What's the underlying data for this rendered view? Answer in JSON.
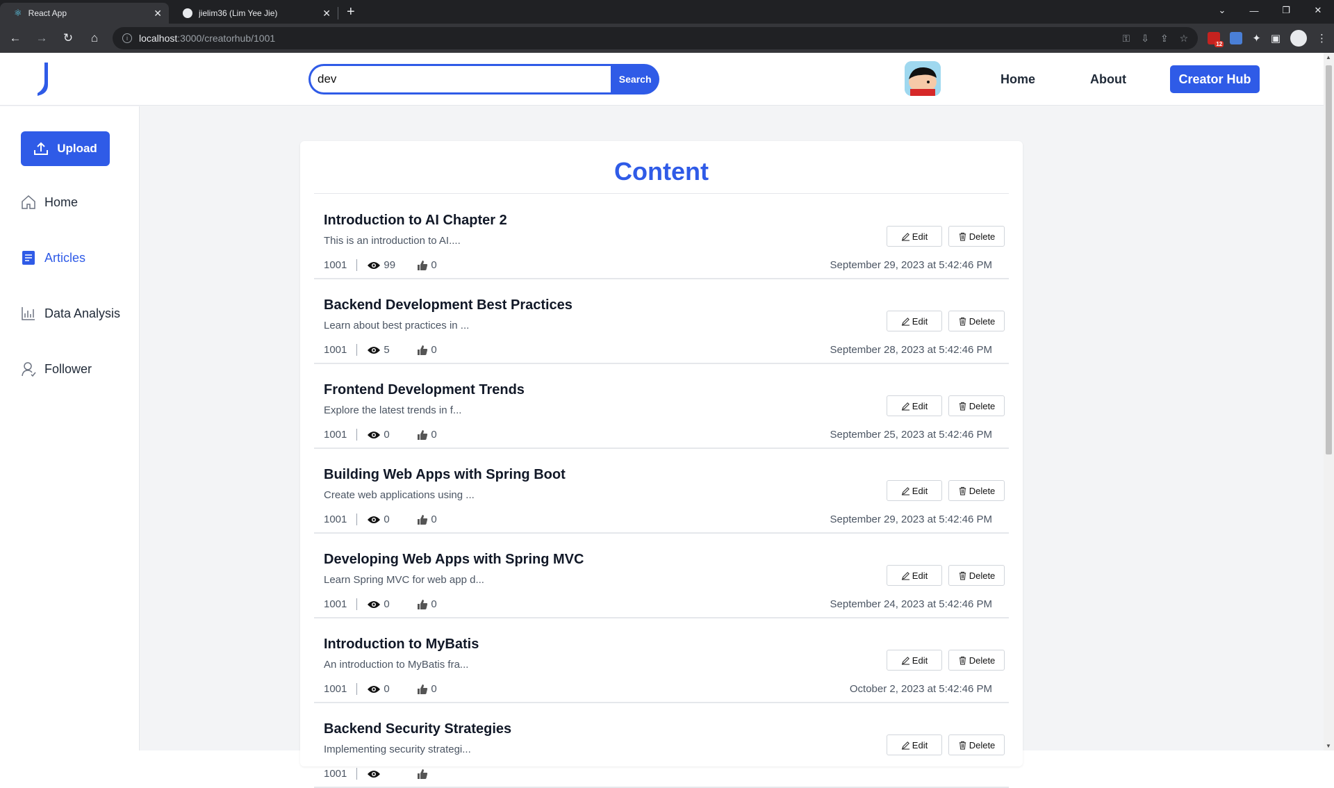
{
  "browser": {
    "tabs": [
      {
        "title": "React App",
        "active": true
      },
      {
        "title": "jielim36 (Lim Yee Jie)",
        "active": false
      }
    ],
    "url_host": "localhost",
    "url_path": ":3000/creatorhub/1001",
    "extension_badge": "12"
  },
  "header": {
    "search_value": "dev",
    "search_label": "Search",
    "nav": {
      "home": "Home",
      "about": "About",
      "creator_hub": "Creator Hub"
    }
  },
  "sidebar": {
    "upload_label": "Upload",
    "items": [
      {
        "label": "Home",
        "active": false
      },
      {
        "label": "Articles",
        "active": true
      },
      {
        "label": "Data Analysis",
        "active": false
      },
      {
        "label": "Follower",
        "active": false
      }
    ]
  },
  "content": {
    "title": "Content",
    "edit_label": "Edit",
    "delete_label": "Delete",
    "articles": [
      {
        "title": "Introduction to AI Chapter 2",
        "desc": "This is an introduction to AI....",
        "id": "1001",
        "views": "99",
        "likes": "0",
        "date": "September 29, 2023 at 5:42:46 PM"
      },
      {
        "title": "Backend Development Best Practices",
        "desc": "Learn about best practices in ...",
        "id": "1001",
        "views": "5",
        "likes": "0",
        "date": "September 28, 2023 at 5:42:46 PM"
      },
      {
        "title": "Frontend Development Trends",
        "desc": "Explore the latest trends in f...",
        "id": "1001",
        "views": "0",
        "likes": "0",
        "date": "September 25, 2023 at 5:42:46 PM"
      },
      {
        "title": "Building Web Apps with Spring Boot",
        "desc": "Create web applications using ...",
        "id": "1001",
        "views": "0",
        "likes": "0",
        "date": "September 29, 2023 at 5:42:46 PM"
      },
      {
        "title": "Developing Web Apps with Spring MVC",
        "desc": "Learn Spring MVC for web app d...",
        "id": "1001",
        "views": "0",
        "likes": "0",
        "date": "September 24, 2023 at 5:42:46 PM"
      },
      {
        "title": "Introduction to MyBatis",
        "desc": "An introduction to MyBatis fra...",
        "id": "1001",
        "views": "0",
        "likes": "0",
        "date": "October 2, 2023 at 5:42:46 PM"
      },
      {
        "title": "Backend Security Strategies",
        "desc": "Implementing security strategi...",
        "id": "1001",
        "views": "",
        "likes": "",
        "date": ""
      }
    ]
  },
  "colors": {
    "accent": "#2f5be7",
    "text": "#111827",
    "muted": "#4b5563"
  }
}
